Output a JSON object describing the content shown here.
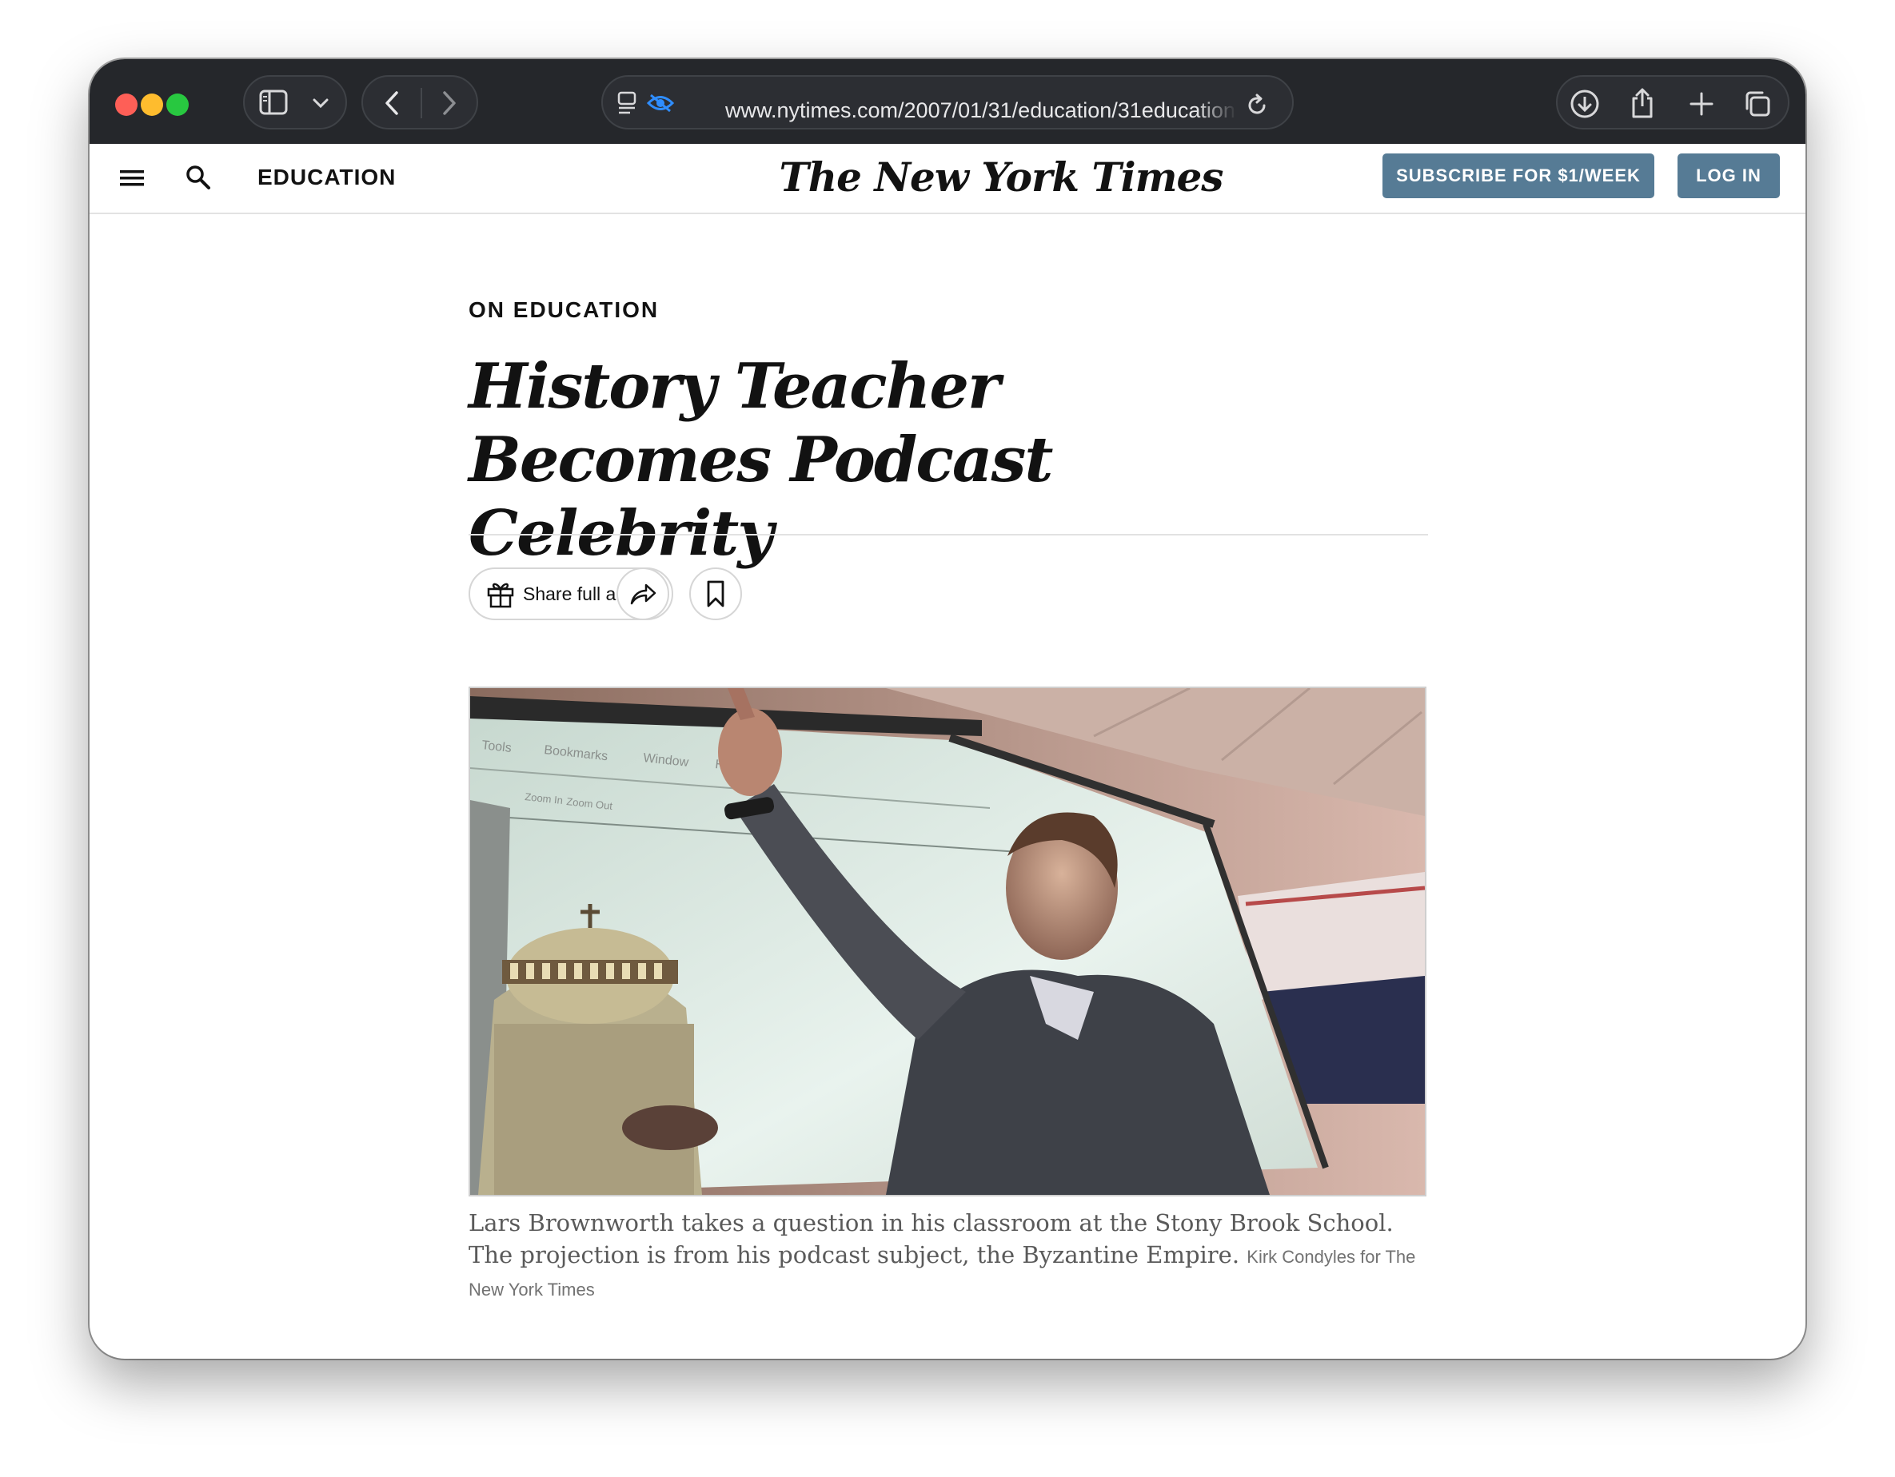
{
  "browser": {
    "url": "www.nytimes.com/2007/01/31/education/31education"
  },
  "header": {
    "section": "EDUCATION",
    "masthead": "The New York Times",
    "subscribe_label": "SUBSCRIBE FOR $1/WEEK",
    "login_label": "LOG IN"
  },
  "article": {
    "kicker": "ON EDUCATION",
    "headline": "History Teacher Becomes Podcast Celebrity",
    "share_label": "Share full article",
    "photo_menu": [
      "Tools",
      "Bookmarks",
      "Window",
      "Help",
      "Zoom In",
      "Zoom Out"
    ],
    "caption": "Lars Brownworth takes a question in his classroom at the Stony Brook School. The projection is from his podcast subject, the Byzantine Empire.",
    "credit": "Kirk Condyles for The New York Times"
  },
  "colors": {
    "toolbar_bg": "#25272b",
    "nyt_button": "#567b95",
    "close": "#fe5f57",
    "minimize": "#febc2e",
    "zoom": "#28c840"
  }
}
